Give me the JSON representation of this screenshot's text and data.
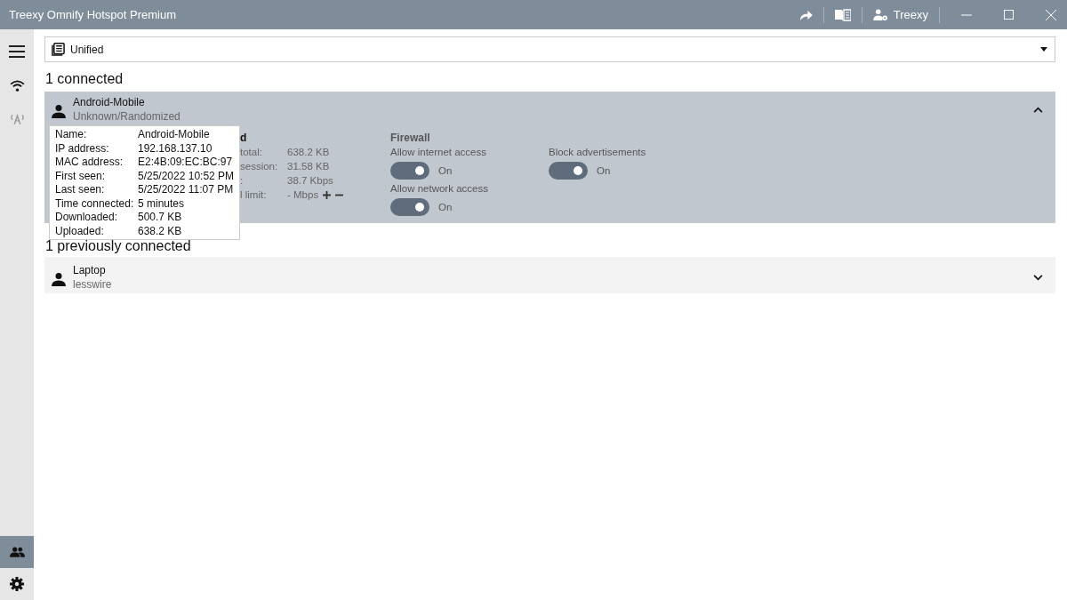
{
  "window": {
    "title": "Treexy Omnify Hotspot Premium",
    "user": "Treexy"
  },
  "sidebar": {
    "items": [
      {
        "kind": "menu",
        "selected": false
      },
      {
        "kind": "wifi",
        "selected": false
      },
      {
        "kind": "antenna",
        "selected": false
      }
    ],
    "bottom_items": [
      {
        "kind": "users",
        "selected": true
      },
      {
        "kind": "settings",
        "selected": false
      }
    ]
  },
  "view_select": {
    "value": "Unified"
  },
  "connected": {
    "heading": "1 connected",
    "devices": [
      {
        "name": "Android-Mobile",
        "vendor": "Unknown/Randomized",
        "expanded": true,
        "stats": {
          "heading": "d",
          "rows": [
            {
              "label": "total:",
              "value": "638.2 KB"
            },
            {
              "label": "session:",
              "value": "31.58 KB"
            },
            {
              "label": ":",
              "value": "38.7 Kbps"
            },
            {
              "label": "l limit:",
              "value": "- Mbps",
              "adjust": true
            }
          ]
        },
        "firewall": {
          "heading": "Firewall",
          "toggles": [
            {
              "label": "Allow internet access",
              "on": true,
              "state": "On"
            },
            {
              "label": "Allow network access",
              "on": true,
              "state": "On"
            }
          ]
        },
        "extra_toggles": [
          {
            "label": "Block advertisements",
            "on": true,
            "state": "On"
          }
        ]
      }
    ]
  },
  "tooltip": {
    "rows": [
      {
        "label": "Name:",
        "value": "Android-Mobile"
      },
      {
        "label": "IP address:",
        "value": "192.168.137.10"
      },
      {
        "label": "MAC address:",
        "value": "E2:4B:09:EC:BC:97"
      },
      {
        "label": "First seen:",
        "value": "5/25/2022 10:52 PM"
      },
      {
        "label": "Last seen:",
        "value": "5/25/2022 11:07 PM"
      },
      {
        "label": "Time connected:",
        "value": "5 minutes"
      },
      {
        "label": "Downloaded:",
        "value": "500.7 KB"
      },
      {
        "label": "Uploaded:",
        "value": "638.2 KB"
      }
    ]
  },
  "previous": {
    "heading": "1 previously connected",
    "devices": [
      {
        "name": "Laptop",
        "vendor": "lesswire",
        "expanded": false
      }
    ]
  }
}
